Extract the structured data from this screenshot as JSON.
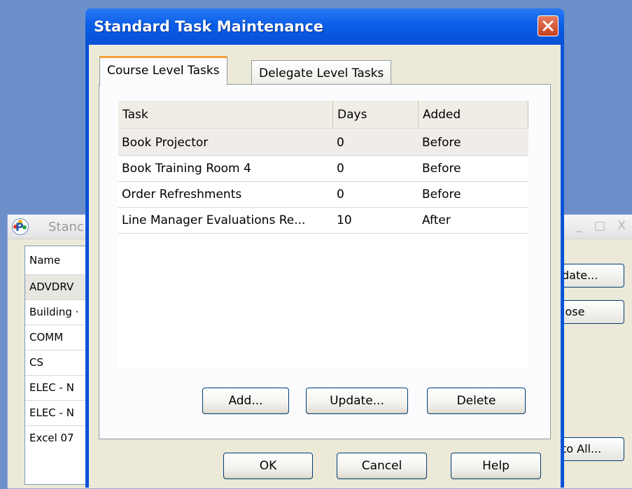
{
  "background_window": {
    "title": "Stanc",
    "window_controls": "_ □ X",
    "list_header": "Name",
    "rows": [
      "ADVDRV",
      "Building ·",
      "COMM",
      "CS",
      "ELEC - N",
      "ELEC - N",
      "Excel 07"
    ],
    "buttons": {
      "update": "date...",
      "close": "lose",
      "to_all": "to All..."
    }
  },
  "dialog": {
    "title": "Standard Task Maintenance",
    "tabs": [
      "Course Level Tasks",
      "Delegate Level Tasks"
    ],
    "active_tab": "Course Level Tasks",
    "columns": [
      "Task",
      "Days",
      "Added"
    ],
    "rows": [
      {
        "task": "Book Projector",
        "days": "0",
        "added": "Before"
      },
      {
        "task": "Book Training Room 4",
        "days": "0",
        "added": "Before"
      },
      {
        "task": "Order Refreshments",
        "days": "0",
        "added": "Before"
      },
      {
        "task": "Line Manager Evaluations Re...",
        "days": "10",
        "added": "After"
      }
    ],
    "panel_buttons": {
      "add": "Add...",
      "update": "Update...",
      "delete": "Delete"
    },
    "footer_buttons": {
      "ok": "OK",
      "cancel": "Cancel",
      "help": "Help"
    }
  },
  "colors": {
    "titlebar_blue": "#0a5ee8",
    "close_red": "#c6401d",
    "active_tab_accent": "#f3a33a",
    "dialog_face": "#ece9d8"
  }
}
